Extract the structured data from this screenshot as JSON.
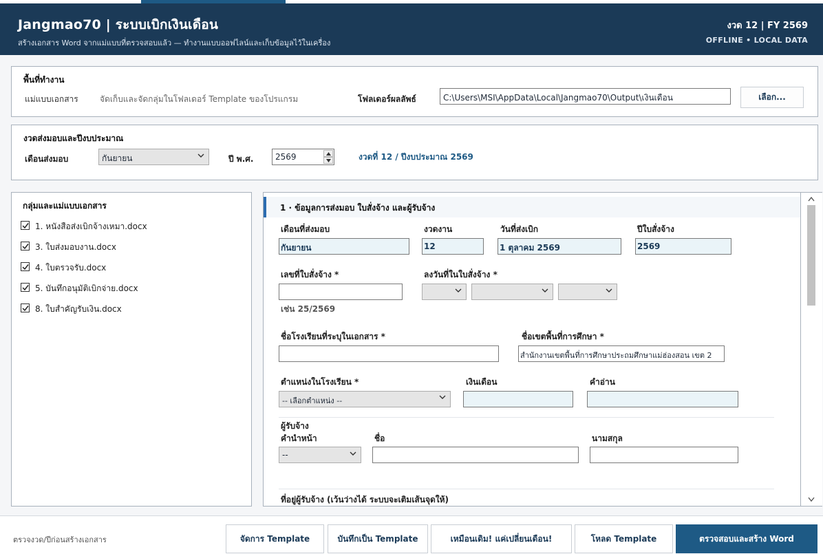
{
  "header": {
    "title": "Jangmao70  |  ระบบเบิกเงินเดือน",
    "subtitle": "สร้างเอกสาร Word จากแม่แบบที่ตรวจสอบแล้ว — ทำงานแบบออฟไลน์และเก็บข้อมูลไว้ในเครื่อง",
    "period": "งวด 12 | FY 2569",
    "status": "OFFLINE  •  LOCAL DATA"
  },
  "workspace": {
    "title": "พื้นที่ทำงาน",
    "template_label": "แม่แบบเอกสาร",
    "template_hint": "จัดเก็บและจัดกลุ่มในโฟลเดอร์ Template ของโปรแกรม",
    "output_label": "โฟลเดอร์ผลลัพธ์",
    "output_path": "C:\\Users\\MSI\\AppData\\Local\\Jangmao70\\Output\\เงินเดือน",
    "browse_button": "เลือก..."
  },
  "period_panel": {
    "title": "งวดส่งมอบและปีงบประมาณ",
    "month_label": "เดือนส่งมอบ",
    "month_value": "กันยายน",
    "year_label": "ปี พ.ศ.",
    "year_value": "2569",
    "info": "งวดที่ 12 / ปีงบประมาณ 2569"
  },
  "templates": {
    "title": "กลุ่มและแม่แบบเอกสาร",
    "items": [
      {
        "label": "1. หนังสือส่งเบิกจ้างเหมา.docx",
        "checked": true
      },
      {
        "label": "3. ใบส่งมอบงาน.docx",
        "checked": true
      },
      {
        "label": "4. ใบตรวจรับ.docx",
        "checked": true
      },
      {
        "label": "5. บันทึกอนุมัติเบิกจ่าย.docx",
        "checked": true
      },
      {
        "label": "8. ใบสำคัญรับเงิน.docx",
        "checked": true
      }
    ]
  },
  "form": {
    "section_title": "1 · ข้อมูลการส่งมอบ ใบสั่งจ้าง และผู้รับจ้าง",
    "delivery_month_label": "เดือนที่ส่งมอบ",
    "delivery_month_value": "กันยายน",
    "installment_label": "งวดงาน",
    "installment_value": "12",
    "disburse_date_label": "วันที่ส่งเบิก",
    "disburse_date_value": "1 ตุลาคม 2569",
    "order_year_label": "ปีใบสั่งจ้าง",
    "order_year_value": "2569",
    "order_no_label": "เลขที่ใบสั่งจ้าง *",
    "order_no_value": "",
    "order_no_example": "เช่น 25/2569",
    "order_date_label": "ลงวันที่ในใบสั่งจ้าง *",
    "school_label": "ชื่อโรงเรียนที่ระบุในเอกสาร *",
    "school_value": "",
    "area_label": "ชื่อเขตพื้นที่การศึกษา *",
    "area_value": "สำนักงานเขตพื้นที่การศึกษาประถมศึกษาแม่ฮ่องสอน เขต 2",
    "position_label": "ตำแหน่งในโรงเรียน *",
    "position_value": "-- เลือกตำแหน่ง --",
    "salary_label": "เงินเดือน",
    "salary_value": "",
    "salary_text_label": "คำอ่าน",
    "salary_text_value": "",
    "contractor_label": "ผู้รับจ้าง",
    "prefix_label": "คำนำหน้า",
    "prefix_value": "--",
    "firstname_label": "ชื่อ",
    "firstname_value": "",
    "lastname_label": "นามสกุล",
    "lastname_value": "",
    "address_label": "ที่อยู่ผู้รับจ้าง (เว้นว่างได้ ระบบจะเติมเส้นจุดให้)"
  },
  "footer": {
    "note": "ตรวจงวด/ปีก่อนสร้างเอกสาร",
    "buttons": {
      "manage": "จัดการ Template",
      "save_as": "บันทึกเป็น Template",
      "same_as_before": "เหมือนเดิม! แค่เปลี่ยนเดือน!",
      "load": "โหลด Template",
      "generate": "ตรวจสอบและสร้าง Word"
    }
  },
  "icons": [
    "chevron-down-icon",
    "spin-up-icon",
    "spin-down-icon",
    "checkmark-icon",
    "scroll-up-icon",
    "scroll-down-icon"
  ],
  "colors": {
    "header_bg": "#1b3a57",
    "accent": "#1e5a85",
    "readonly_bg": "#eaf4f8"
  }
}
